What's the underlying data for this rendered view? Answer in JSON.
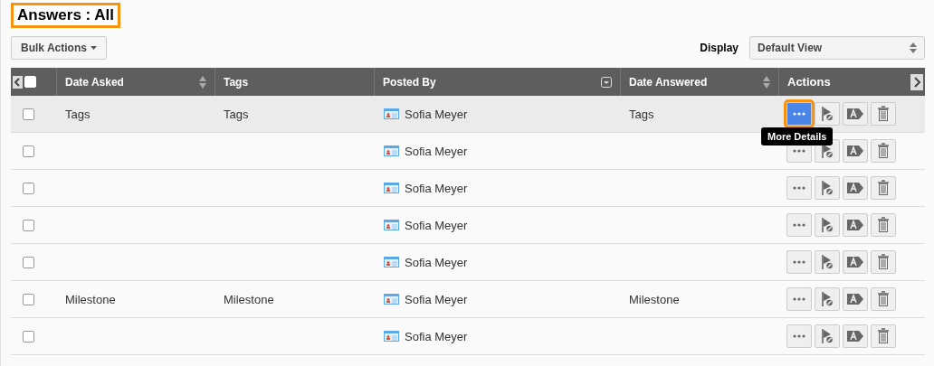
{
  "title": "Answers : All",
  "bulk_actions": {
    "label": "Bulk Actions"
  },
  "display": {
    "label": "Display",
    "value": "Default View"
  },
  "table": {
    "select_all_checked": false,
    "columns": [
      {
        "label": "Date Asked",
        "kind": "sort"
      },
      {
        "label": "Tags",
        "kind": "plain"
      },
      {
        "label": "Posted By",
        "kind": "filter"
      },
      {
        "label": "Date Answered",
        "kind": "sort"
      },
      {
        "label": "Actions",
        "kind": "plain"
      }
    ],
    "rows": [
      {
        "checked": false,
        "highlighted": true,
        "date_asked": "Tags",
        "tags": "Tags",
        "posted_by": "Sofia Meyer",
        "date_answered": "Tags",
        "more_active": true
      },
      {
        "checked": false,
        "highlighted": false,
        "posted_by": "Sofia Meyer",
        "more_active": false
      },
      {
        "checked": false,
        "highlighted": false,
        "posted_by": "Sofia Meyer",
        "more_active": false
      },
      {
        "checked": false,
        "highlighted": false,
        "posted_by": "Sofia Meyer",
        "more_active": false
      },
      {
        "checked": false,
        "highlighted": false,
        "posted_by": "Sofia Meyer",
        "more_active": false
      },
      {
        "checked": false,
        "highlighted": false,
        "date_asked": "Milestone",
        "tags": "Milestone",
        "posted_by": "Sofia Meyer",
        "date_answered": "Milestone",
        "more_active": false
      },
      {
        "checked": false,
        "highlighted": false,
        "posted_by": "Sofia Meyer",
        "more_active": false
      }
    ]
  },
  "tooltip": {
    "text": "More Details"
  }
}
